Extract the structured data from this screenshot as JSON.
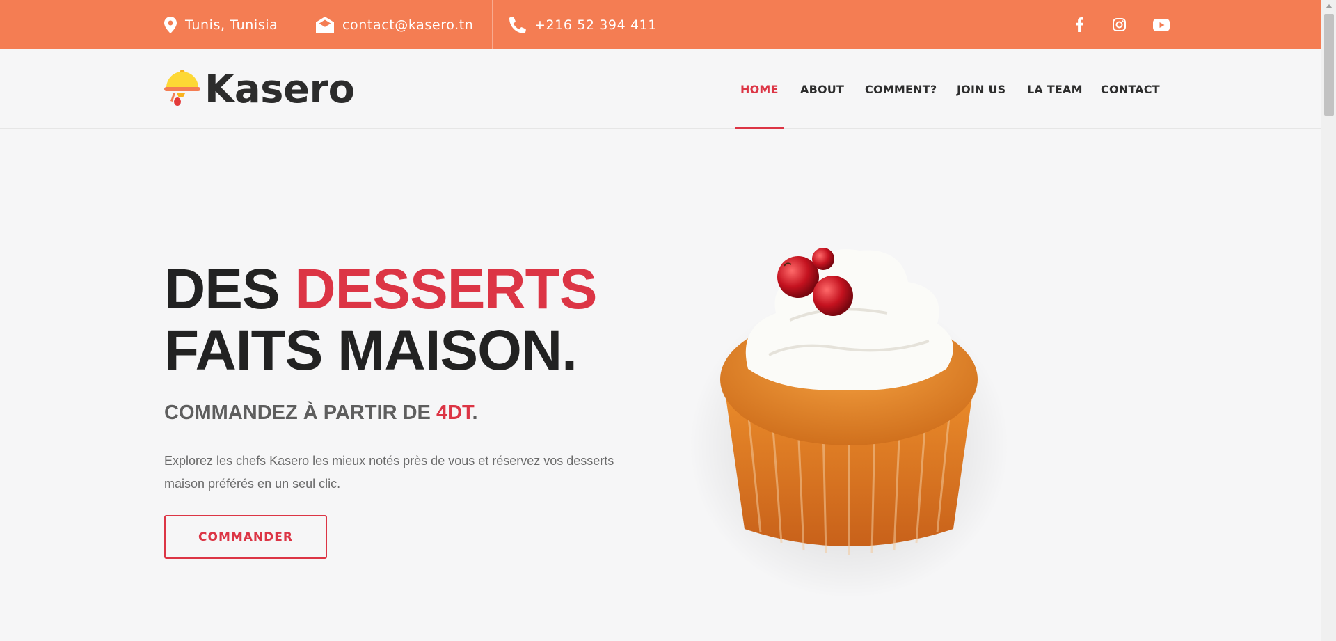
{
  "topbar": {
    "location": "Tunis, Tunisia",
    "email": "contact@kasero.tn",
    "phone": "+216 52 394 411",
    "social": [
      "facebook-icon",
      "instagram-icon",
      "youtube-icon"
    ]
  },
  "brand": {
    "name": "Kasero",
    "logo_icon": "cloche-icon"
  },
  "nav": {
    "items": [
      {
        "label": "HOME",
        "active": true
      },
      {
        "label": "ABOUT",
        "active": false
      },
      {
        "label": "COMMENT?",
        "active": false
      },
      {
        "label": "JOIN US",
        "active": false
      },
      {
        "label": "LA TEAM",
        "active": false
      },
      {
        "label": "CONTACT",
        "active": false
      }
    ]
  },
  "hero": {
    "title_part1": "DES ",
    "title_accent": "DESSERTS",
    "title_line2": "FAITS MAISON.",
    "subtitle_part1": "COMMANDEZ À PARTIR DE ",
    "subtitle_accent": "4DT",
    "subtitle_end": ".",
    "description": "Explorez les chefs Kasero les mieux notés près de vous et réservez vos desserts maison préférés en un seul clic.",
    "cta_label": "COMMANDER",
    "image": "cupcake-image"
  },
  "colors": {
    "topbar_bg": "#f47d53",
    "accent": "#dc3545",
    "text_dark": "#222222",
    "page_bg": "#f6f6f7"
  }
}
